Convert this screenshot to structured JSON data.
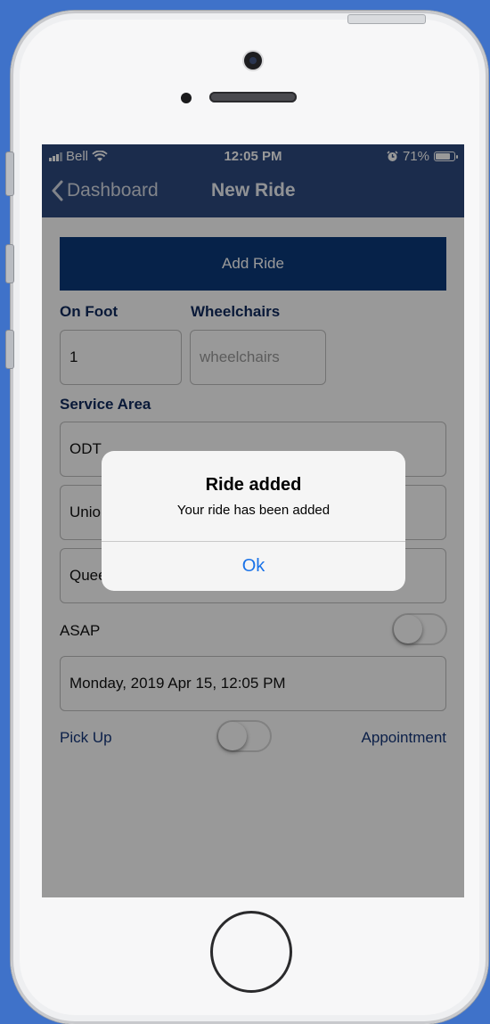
{
  "status_bar": {
    "carrier": "Bell",
    "time": "12:05 PM",
    "battery_percent": "71%"
  },
  "nav": {
    "back_label": "Dashboard",
    "title": "New Ride"
  },
  "form": {
    "add_ride_label": "Add Ride",
    "on_foot_label": "On Foot",
    "on_foot_value": "1",
    "wheelchairs_label": "Wheelchairs",
    "wheelchairs_placeholder": "wheelchairs",
    "service_area_label": "Service Area",
    "service_area_value": "ODT",
    "field_2_value": "Unio",
    "field_3_value": "Quee",
    "asap_label": "ASAP",
    "asap_on": false,
    "datetime_value": "Monday, 2019 Apr 15, 12:05 PM",
    "pickup_label": "Pick Up",
    "appointment_label": "Appointment",
    "pickup_appointment_on": false
  },
  "alert": {
    "title": "Ride added",
    "message": "Your ride has been added",
    "ok_label": "Ok"
  },
  "colors": {
    "background": "#3f72c9",
    "nav_bar": "#2e4a7f",
    "primary_button": "#0a3a7a",
    "label_text": "#102a5e",
    "alert_action": "#1a73e8"
  },
  "icons": [
    "signal-icon",
    "wifi-icon",
    "alarm-icon",
    "battery-icon",
    "chevron-left-icon"
  ]
}
